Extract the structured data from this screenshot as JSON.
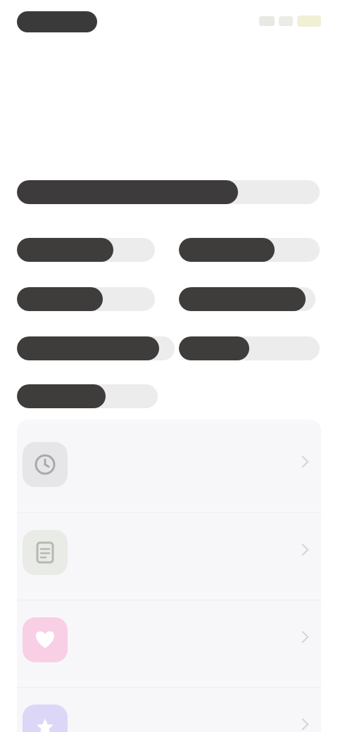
{
  "status_bar": {
    "time": "",
    "icons": [
      "signal-icon",
      "wifi-icon",
      "battery-icon"
    ]
  },
  "header": {
    "title": "",
    "subtitle": ""
  },
  "progress": {
    "fraction": 0.73,
    "track_color": "#ececec",
    "fill_color": "#3d3b3b"
  },
  "options": [
    {
      "label": "",
      "fill": 0.7
    },
    {
      "label": "",
      "fill": 0.68
    },
    {
      "label": "",
      "fill": 0.62
    },
    {
      "label": "",
      "fill": 0.93
    },
    {
      "label": "",
      "fill": 0.9
    },
    {
      "label": "",
      "fill": 0.5
    },
    {
      "label": "",
      "fill": 0.63
    }
  ],
  "list": {
    "items": [
      {
        "title": "",
        "subtitle": "",
        "icon": "clock-icon",
        "icon_color": "#e6e6e9"
      },
      {
        "title": "",
        "subtitle": "",
        "icon": "document-icon",
        "icon_color": "#e8ebe6"
      },
      {
        "title": "",
        "subtitle": "",
        "icon": "heart-icon",
        "icon_color": "#f9cfe6"
      },
      {
        "title": "",
        "subtitle": "",
        "icon": "star-icon",
        "icon_color": "#dcd6f7"
      }
    ]
  }
}
